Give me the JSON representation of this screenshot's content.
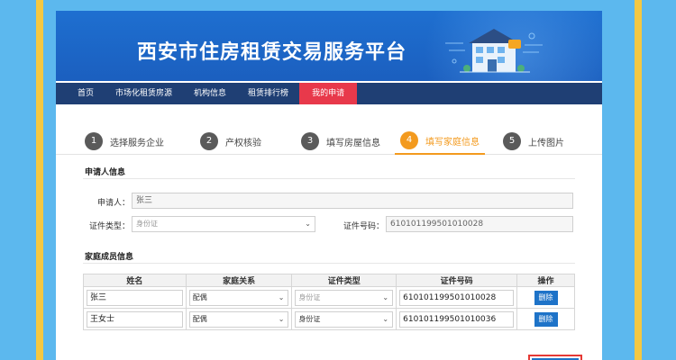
{
  "header": {
    "title": "西安市住房租赁交易服务平台"
  },
  "nav": {
    "items": [
      {
        "label": "首页"
      },
      {
        "label": "市场化租赁房源"
      },
      {
        "label": "机构信息"
      },
      {
        "label": "租赁排行榜"
      },
      {
        "label": "我的申请",
        "active": true
      }
    ]
  },
  "steps": [
    {
      "num": "1",
      "label": "选择服务企业"
    },
    {
      "num": "2",
      "label": "产权核验"
    },
    {
      "num": "3",
      "label": "填写房屋信息"
    },
    {
      "num": "4",
      "label": "填写家庭信息",
      "active": true
    },
    {
      "num": "5",
      "label": "上传图片"
    }
  ],
  "applicant": {
    "section_title": "申请人信息",
    "name_label": "申请人：",
    "name_value": "张三",
    "idtype_label": "证件类型：",
    "idtype_placeholder": "身份证",
    "idnum_label": "证件号码：",
    "idnum_value": "610101199501010028"
  },
  "family": {
    "section_title": "家庭成员信息",
    "columns": [
      "姓名",
      "家庭关系",
      "证件类型",
      "证件号码",
      "操作"
    ],
    "rows": [
      {
        "name": "张三",
        "relation": "配偶",
        "idtype": "身份证",
        "idnum": "610101199501010028",
        "action": "删除"
      },
      {
        "name": "王女士",
        "relation": "配偶",
        "idtype": "身份证",
        "idnum": "610101199501010036",
        "action": "删除"
      }
    ]
  },
  "colors": {
    "accent": "#1e73c8",
    "active_nav": "#e8394b",
    "active_step": "#f39a1e"
  }
}
